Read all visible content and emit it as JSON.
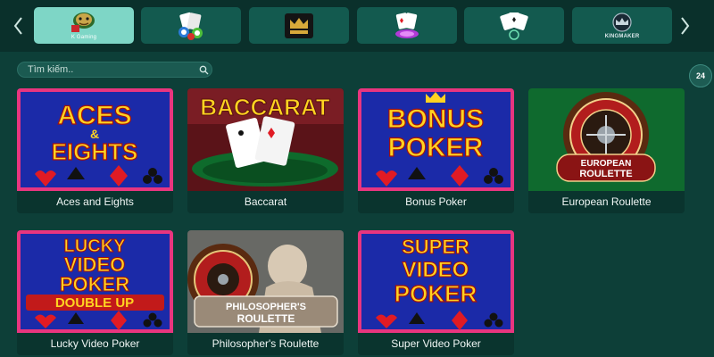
{
  "providers": {
    "tabs": [
      {
        "icon": "kings-gaming-logo",
        "label": "K Gaming",
        "active": true
      },
      {
        "icon": "cards-chips-logo",
        "label": "",
        "active": false
      },
      {
        "icon": "golden-crown-logo",
        "label": "",
        "active": false
      },
      {
        "icon": "poker-cards-logo",
        "label": "",
        "active": false
      },
      {
        "icon": "playing-cards-logo",
        "label": "",
        "active": false
      },
      {
        "icon": "kingmaker-logo",
        "label": "KINGMAKER",
        "active": false
      }
    ],
    "prev_icon": "chevron-left-icon",
    "next_icon": "chevron-right-icon"
  },
  "search": {
    "placeholder": "Tìm kiếm..",
    "icon": "search-icon"
  },
  "support": {
    "label": "24",
    "icon": "support-24-icon"
  },
  "games": [
    {
      "title": "Aces and Eights",
      "art": [
        "ACES",
        "&",
        "EIGHTS"
      ]
    },
    {
      "title": "Baccarat",
      "art": [
        "BACCARAT"
      ]
    },
    {
      "title": "Bonus Poker",
      "art": [
        "BONUS",
        "POKER"
      ]
    },
    {
      "title": "European Roulette",
      "art": [
        "EUROPEAN",
        "ROULETTE"
      ]
    },
    {
      "title": "Lucky Video Poker",
      "art": [
        "LUCKY",
        "VIDEO",
        "POKER",
        "DOUBLE UP"
      ]
    },
    {
      "title": "Philosopher's Roulette",
      "art": [
        "PHILOSOPHER'S",
        "ROULETTE"
      ]
    },
    {
      "title": "Super Video Poker",
      "art": [
        "SUPER",
        "VIDEO",
        "POKER"
      ]
    }
  ],
  "colors": {
    "background": "#0b3b34",
    "active_tab": "#7ed6c6",
    "tab": "#135a4f",
    "poker_frame": "#e8357f",
    "poker_panel": "#1b2aa8",
    "poker_text": "#ffd321",
    "suit_red": "#e01b24"
  }
}
